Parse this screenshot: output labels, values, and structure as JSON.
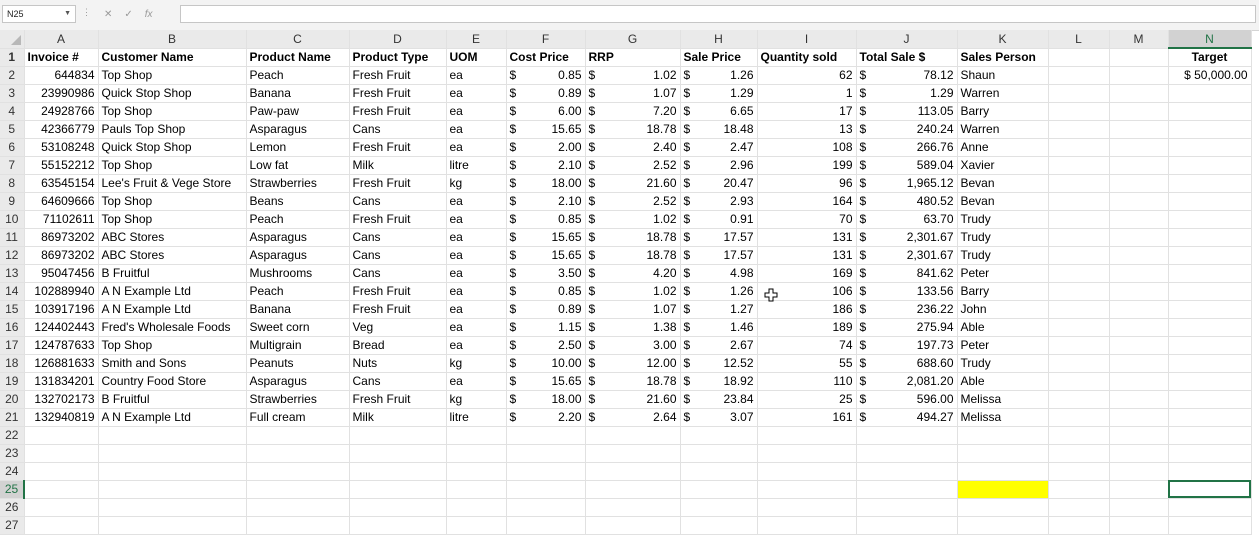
{
  "name_box": "N25",
  "formula_icons": {
    "cancel": "✕",
    "enter": "✓",
    "fx": "fx"
  },
  "columns": [
    "A",
    "B",
    "C",
    "D",
    "E",
    "F",
    "G",
    "H",
    "I",
    "J",
    "K",
    "L",
    "M",
    "N"
  ],
  "headers": {
    "A": "Invoice #",
    "B": "Customer Name",
    "C": "Product Name",
    "D": "Product Type",
    "E": "UOM",
    "F": "Cost Price",
    "G": "RRP",
    "H": "Sale Price",
    "I": "Quantity sold",
    "J": "Total Sale $",
    "K": "Sales Person",
    "N": "Target"
  },
  "currency_symbol": "$",
  "target_value": "$ 50,000.00",
  "rows": [
    {
      "inv": "644834",
      "cust": "Top Shop",
      "prod": "Peach",
      "type": "Fresh Fruit",
      "uom": "ea",
      "cost": "0.85",
      "rrp": "1.02",
      "sale": "1.26",
      "qty": "62",
      "total": "78.12",
      "person": "Shaun"
    },
    {
      "inv": "23990986",
      "cust": "Quick Stop Shop",
      "prod": "Banana",
      "type": "Fresh Fruit",
      "uom": "ea",
      "cost": "0.89",
      "rrp": "1.07",
      "sale": "1.29",
      "qty": "1",
      "total": "1.29",
      "person": "Warren"
    },
    {
      "inv": "24928766",
      "cust": "Top Shop",
      "prod": "Paw-paw",
      "type": "Fresh Fruit",
      "uom": "ea",
      "cost": "6.00",
      "rrp": "7.20",
      "sale": "6.65",
      "qty": "17",
      "total": "113.05",
      "person": "Barry"
    },
    {
      "inv": "42366779",
      "cust": "Pauls Top Shop",
      "prod": "Asparagus",
      "type": "Cans",
      "uom": "ea",
      "cost": "15.65",
      "rrp": "18.78",
      "sale": "18.48",
      "qty": "13",
      "total": "240.24",
      "person": "Warren"
    },
    {
      "inv": "53108248",
      "cust": "Quick Stop Shop",
      "prod": "Lemon",
      "type": "Fresh Fruit",
      "uom": "ea",
      "cost": "2.00",
      "rrp": "2.40",
      "sale": "2.47",
      "qty": "108",
      "total": "266.76",
      "person": "Anne"
    },
    {
      "inv": "55152212",
      "cust": "Top Shop",
      "prod": "Low fat",
      "type": "Milk",
      "uom": "litre",
      "cost": "2.10",
      "rrp": "2.52",
      "sale": "2.96",
      "qty": "199",
      "total": "589.04",
      "person": "Xavier"
    },
    {
      "inv": "63545154",
      "cust": "Lee's Fruit & Vege Store",
      "prod": "Strawberries",
      "type": "Fresh Fruit",
      "uom": "kg",
      "cost": "18.00",
      "rrp": "21.60",
      "sale": "20.47",
      "qty": "96",
      "total": "1,965.12",
      "person": "Bevan"
    },
    {
      "inv": "64609666",
      "cust": "Top Shop",
      "prod": "Beans",
      "type": "Cans",
      "uom": "ea",
      "cost": "2.10",
      "rrp": "2.52",
      "sale": "2.93",
      "qty": "164",
      "total": "480.52",
      "person": "Bevan"
    },
    {
      "inv": "71102611",
      "cust": "Top Shop",
      "prod": "Peach",
      "type": "Fresh Fruit",
      "uom": "ea",
      "cost": "0.85",
      "rrp": "1.02",
      "sale": "0.91",
      "qty": "70",
      "total": "63.70",
      "person": "Trudy"
    },
    {
      "inv": "86973202",
      "cust": "ABC Stores",
      "prod": "Asparagus",
      "type": "Cans",
      "uom": "ea",
      "cost": "15.65",
      "rrp": "18.78",
      "sale": "17.57",
      "qty": "131",
      "total": "2,301.67",
      "person": "Trudy"
    },
    {
      "inv": "86973202",
      "cust": "ABC Stores",
      "prod": "Asparagus",
      "type": "Cans",
      "uom": "ea",
      "cost": "15.65",
      "rrp": "18.78",
      "sale": "17.57",
      "qty": "131",
      "total": "2,301.67",
      "person": "Trudy"
    },
    {
      "inv": "95047456",
      "cust": "B Fruitful",
      "prod": "Mushrooms",
      "type": "Cans",
      "uom": "ea",
      "cost": "3.50",
      "rrp": "4.20",
      "sale": "4.98",
      "qty": "169",
      "total": "841.62",
      "person": "Peter"
    },
    {
      "inv": "102889940",
      "cust": "A N Example Ltd",
      "prod": "Peach",
      "type": "Fresh Fruit",
      "uom": "ea",
      "cost": "0.85",
      "rrp": "1.02",
      "sale": "1.26",
      "qty": "106",
      "total": "133.56",
      "person": "Barry"
    },
    {
      "inv": "103917196",
      "cust": "A N Example Ltd",
      "prod": "Banana",
      "type": "Fresh Fruit",
      "uom": "ea",
      "cost": "0.89",
      "rrp": "1.07",
      "sale": "1.27",
      "qty": "186",
      "total": "236.22",
      "person": "John"
    },
    {
      "inv": "124402443",
      "cust": "Fred's Wholesale Foods",
      "prod": "Sweet corn",
      "type": "Veg",
      "uom": "ea",
      "cost": "1.15",
      "rrp": "1.38",
      "sale": "1.46",
      "qty": "189",
      "total": "275.94",
      "person": "Able"
    },
    {
      "inv": "124787633",
      "cust": "Top Shop",
      "prod": "Multigrain",
      "type": "Bread",
      "uom": "ea",
      "cost": "2.50",
      "rrp": "3.00",
      "sale": "2.67",
      "qty": "74",
      "total": "197.73",
      "person": "Peter"
    },
    {
      "inv": "126881633",
      "cust": "Smith and Sons",
      "prod": "Peanuts",
      "type": "Nuts",
      "uom": "kg",
      "cost": "10.00",
      "rrp": "12.00",
      "sale": "12.52",
      "qty": "55",
      "total": "688.60",
      "person": "Trudy"
    },
    {
      "inv": "131834201",
      "cust": "Country Food Store",
      "prod": "Asparagus",
      "type": "Cans",
      "uom": "ea",
      "cost": "15.65",
      "rrp": "18.78",
      "sale": "18.92",
      "qty": "110",
      "total": "2,081.20",
      "person": "Able"
    },
    {
      "inv": "132702173",
      "cust": "B Fruitful",
      "prod": "Strawberries",
      "type": "Fresh Fruit",
      "uom": "kg",
      "cost": "18.00",
      "rrp": "21.60",
      "sale": "23.84",
      "qty": "25",
      "total": "596.00",
      "person": "Melissa"
    },
    {
      "inv": "132940819",
      "cust": "A N Example Ltd",
      "prod": "Full cream",
      "type": "Milk",
      "uom": "litre",
      "cost": "2.20",
      "rrp": "2.64",
      "sale": "3.07",
      "qty": "161",
      "total": "494.27",
      "person": "Melissa"
    }
  ],
  "empty_row_numbers": [
    "22",
    "23",
    "24",
    "25",
    "26",
    "27"
  ],
  "highlight_color": "#ffff00",
  "selection_color": "#217346"
}
